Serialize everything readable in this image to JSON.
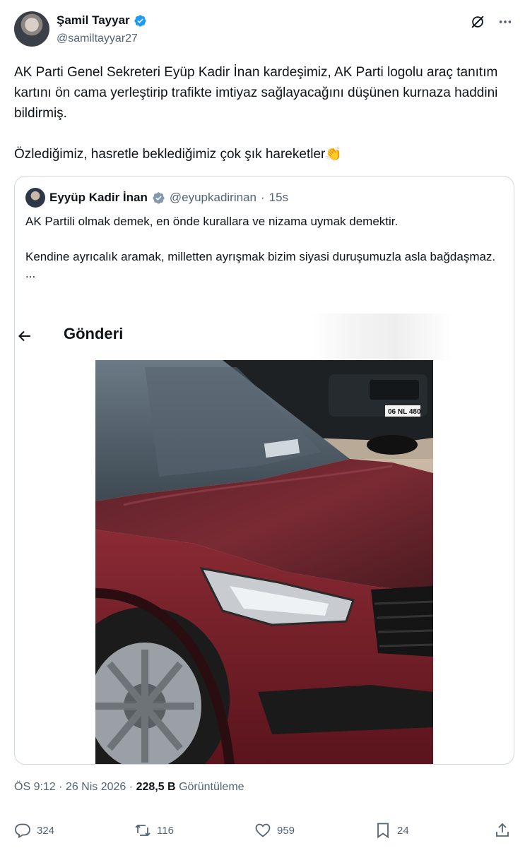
{
  "author": {
    "name": "Şamil Tayyar",
    "handle": "@samiltayyar27"
  },
  "tweet": {
    "paragraph1": "AK Parti Genel Sekreteri Eyüp Kadir İnan kardeşimiz, AK Parti logolu araç tanıtım kartını ön cama yerleştirip trafikte imtiyaz sağlayacağını düşünen kurnaza haddini bildirmiş.",
    "paragraph2": "Özlediğimiz, hasretle beklediğimiz çok şık hareketler",
    "emoji": "👏"
  },
  "quote": {
    "name": "Eyyüp Kadir İnan",
    "handle": "@eyupkadirinan",
    "separator": "·",
    "time": "15s",
    "line1": "AK Partili olmak demek, en önde kurallara ve nizama uymak demektir.",
    "line2": "Kendine ayrıcalık aramak, milletten ayrışmak bizim siyasi duruşumuzla asla bağdaşmaz.",
    "ellipsis": "...",
    "overlay_title": "Gönderi",
    "plate_text": "06 NL 480"
  },
  "meta": {
    "time": "ÖS 9:12",
    "dot1": "·",
    "date": "26 Nis 2026",
    "dot2": "·",
    "views_count": "228,5 B",
    "views_label": "Görüntüleme"
  },
  "actions": {
    "replies": "324",
    "reposts": "116",
    "likes": "959",
    "bookmarks": "24"
  },
  "colors": {
    "verified": "#1d9bf0",
    "secondary_text": "#536471",
    "border": "#cfd9de",
    "car_red": "#7a1f2a"
  }
}
